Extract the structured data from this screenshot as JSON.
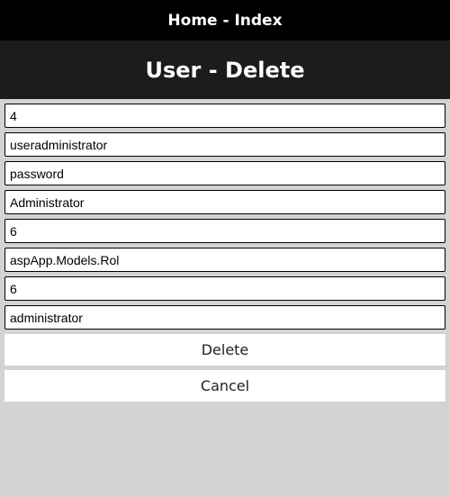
{
  "nav": {
    "home_link": "Home - Index"
  },
  "header": {
    "title": "User - Delete"
  },
  "form": {
    "fields": [
      {
        "name": "id",
        "value": "4"
      },
      {
        "name": "username",
        "value": "useradministrator"
      },
      {
        "name": "password",
        "value": "password"
      },
      {
        "name": "full-name",
        "value": "Administrator"
      },
      {
        "name": "role-id",
        "value": "6"
      },
      {
        "name": "role-object",
        "value": "aspApp.Models.Rol"
      },
      {
        "name": "rol-id",
        "value": "6"
      },
      {
        "name": "rol-name",
        "value": "administrator"
      }
    ],
    "delete_label": "Delete",
    "cancel_label": "Cancel"
  },
  "colors": {
    "nav_bg": "#000000",
    "header_bg": "#1c1c1c",
    "page_bg": "#d3d3d3"
  }
}
